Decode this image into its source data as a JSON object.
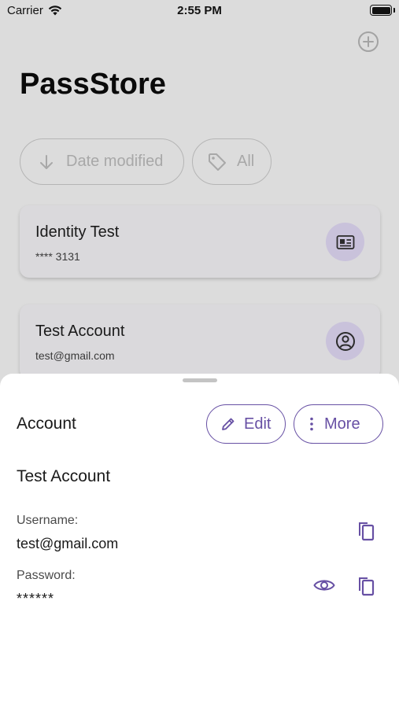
{
  "status": {
    "carrier": "Carrier",
    "time": "2:55 PM"
  },
  "app": {
    "title": "PassStore"
  },
  "filters": {
    "sort_label": "Date modified",
    "tag_label": "All"
  },
  "items": [
    {
      "title": "Identity Test",
      "subtitle": "**** 3131",
      "icon": "id-card-icon"
    },
    {
      "title": "Test Account",
      "subtitle": "test@gmail.com",
      "icon": "account-circle-icon"
    }
  ],
  "sheet": {
    "type_label": "Account",
    "edit_label": "Edit",
    "more_label": "More",
    "name": "Test Account",
    "username_label": "Username:",
    "username_value": "test@gmail.com",
    "password_label": "Password:",
    "password_value": "******"
  },
  "colors": {
    "accent": "#6750a4",
    "scrim": "#dcdcdc",
    "icon_bg": "#c9c2db"
  }
}
